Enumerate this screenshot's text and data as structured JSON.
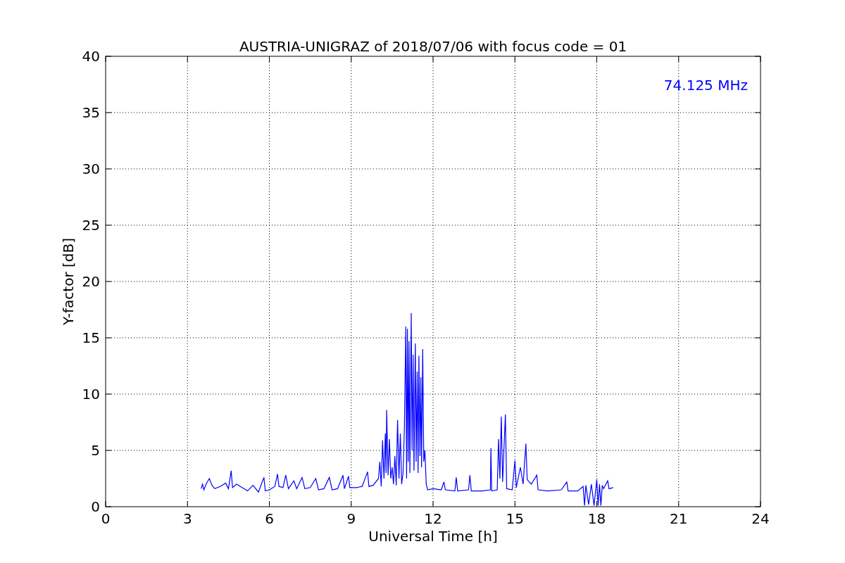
{
  "figure": {
    "chart_data": {
      "type": "line",
      "title": "AUSTRIA-UNIGRAZ of 2018/07/06 with focus code = 01",
      "xlabel": "Universal Time [h]",
      "ylabel": "Y-factor [dB]",
      "x": [
        3.5,
        3.55,
        3.6,
        3.7,
        3.8,
        3.9,
        4.0,
        4.2,
        4.4,
        4.5,
        4.6,
        4.65,
        4.8,
        5.0,
        5.2,
        5.4,
        5.6,
        5.8,
        5.85,
        6.0,
        6.2,
        6.3,
        6.35,
        6.5,
        6.6,
        6.7,
        6.9,
        7.0,
        7.2,
        7.3,
        7.5,
        7.7,
        7.8,
        8.0,
        8.2,
        8.3,
        8.5,
        8.7,
        8.75,
        8.9,
        8.95,
        9.2,
        9.4,
        9.6,
        9.65,
        9.8,
        10.0,
        10.05,
        10.1,
        10.15,
        10.2,
        10.25,
        10.28,
        10.3,
        10.35,
        10.4,
        10.45,
        10.5,
        10.55,
        10.6,
        10.65,
        10.7,
        10.75,
        10.8,
        10.85,
        10.9,
        10.95,
        11.0,
        11.03,
        11.06,
        11.09,
        11.12,
        11.15,
        11.2,
        11.23,
        11.27,
        11.3,
        11.35,
        11.38,
        11.42,
        11.45,
        11.48,
        11.52,
        11.55,
        11.58,
        11.62,
        11.66,
        11.7,
        11.75,
        11.8,
        12.0,
        12.3,
        12.4,
        12.45,
        12.8,
        12.85,
        12.9,
        13.3,
        13.35,
        13.4,
        13.8,
        14.1,
        14.12,
        14.15,
        14.35,
        14.4,
        14.45,
        14.5,
        14.55,
        14.65,
        14.7,
        14.9,
        15.0,
        15.05,
        15.2,
        15.3,
        15.4,
        15.45,
        15.6,
        15.8,
        15.85,
        16.2,
        16.7,
        16.9,
        16.95,
        17.3,
        17.5,
        17.55,
        17.6,
        17.7,
        17.8,
        17.9,
        18.0,
        18.05,
        18.1,
        18.15,
        18.2,
        18.25,
        18.4,
        18.45,
        18.6
      ],
      "series": [
        {
          "color": "#0000ff",
          "values": [
            1.6,
            2.0,
            1.5,
            2.1,
            2.5,
            1.9,
            1.6,
            1.8,
            2.1,
            1.6,
            3.2,
            1.7,
            2.0,
            1.7,
            1.4,
            1.9,
            1.3,
            2.6,
            1.4,
            1.5,
            1.8,
            2.9,
            1.8,
            1.7,
            2.8,
            1.6,
            2.3,
            1.6,
            2.6,
            1.6,
            1.7,
            2.5,
            1.5,
            1.6,
            2.6,
            1.5,
            1.6,
            2.8,
            1.6,
            2.7,
            1.7,
            1.7,
            1.8,
            3.1,
            1.8,
            1.9,
            2.5,
            4.0,
            1.8,
            5.9,
            2.5,
            6.5,
            3.0,
            8.6,
            2.8,
            6.0,
            2.5,
            3.5,
            2.0,
            4.5,
            1.9,
            7.7,
            2.5,
            6.5,
            2.0,
            3.0,
            7.0,
            16.0,
            2.5,
            15.8,
            4.0,
            14.7,
            3.0,
            17.2,
            5.0,
            13.5,
            3.2,
            14.5,
            4.0,
            12.0,
            3.0,
            13.4,
            4.5,
            11.5,
            3.5,
            14.0,
            4.0,
            5.0,
            2.0,
            1.5,
            1.6,
            1.5,
            2.2,
            1.5,
            1.4,
            2.6,
            1.4,
            1.5,
            2.8,
            1.4,
            1.4,
            1.5,
            5.2,
            1.4,
            1.5,
            6.0,
            2.5,
            8.0,
            2.2,
            8.2,
            1.6,
            1.5,
            4.1,
            1.7,
            3.5,
            2.0,
            5.6,
            2.4,
            2.0,
            2.8,
            1.5,
            1.4,
            1.5,
            2.2,
            1.4,
            1.4,
            1.8,
            0.1,
            1.9,
            0.2,
            2.0,
            0.1,
            2.4,
            0.1,
            2.0,
            0.1,
            1.9,
            1.6,
            2.3,
            1.6,
            1.7
          ]
        }
      ],
      "xlim": [
        0,
        24
      ],
      "ylim": [
        0,
        40
      ],
      "xticks": [
        0,
        3,
        6,
        9,
        12,
        15,
        18,
        21,
        24
      ],
      "yticks": [
        0,
        5,
        10,
        15,
        20,
        25,
        30,
        35,
        40
      ],
      "grid": true,
      "annotations": [
        "74.125 MHz"
      ]
    }
  }
}
